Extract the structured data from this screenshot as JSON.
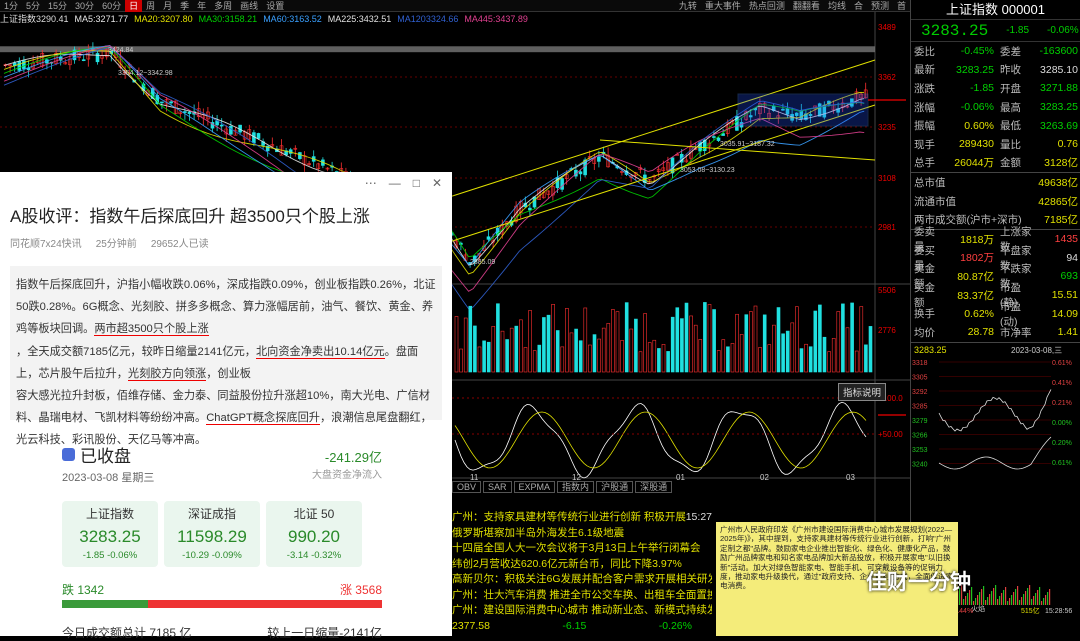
{
  "toolbar": {
    "tabs": [
      "1分",
      "5分",
      "15分",
      "30分",
      "60分",
      "日",
      "周",
      "月",
      "季",
      "年",
      "多周",
      "画线",
      "设置"
    ],
    "active": 5,
    "right": [
      "九转",
      "重大事件",
      "热点回测",
      "翻翻看",
      "均线",
      "合",
      "预测",
      "首"
    ]
  },
  "ma_legend": [
    {
      "label": "上证指数",
      "value": "3290.41",
      "color": "#ddd"
    },
    {
      "label": "MA5:",
      "value": "3271.77",
      "color": "#e8e8e8"
    },
    {
      "label": "MA20:",
      "value": "3207.80",
      "color": "#e0e000"
    },
    {
      "label": "MA30:",
      "value": "3158.21",
      "color": "#00d000"
    },
    {
      "label": "MA60:",
      "value": "3163.52",
      "color": "#3aa0ff"
    },
    {
      "label": "MA225:",
      "value": "3432.51",
      "color": "#e0e0e0"
    },
    {
      "label": "MA120",
      "value": "3324.66",
      "color": "#3060d0"
    },
    {
      "label": "MA445:",
      "value": "3437.89",
      "color": "#e04090"
    }
  ],
  "price_axis": [
    "3489",
    "3362",
    "3235",
    "3108",
    "2981",
    "5506",
    "2776",
    "+100.0",
    "+50.00"
  ],
  "chart_labels": {
    "high": "3424.84",
    "l1": "3354.12~3342.98",
    "low": "2885.09",
    "l2": "3035.91~3187.32",
    "l3": "3053.08~3130.23"
  },
  "dates": [
    "11",
    "12",
    "01",
    "02",
    "03"
  ],
  "indicator_tabs": [
    "OBV",
    "SAR",
    "EXPMA",
    "指数内",
    "沪股通",
    "深股通"
  ],
  "indicator_btn": "指标说明",
  "right_panel": {
    "title": "上证指数 000001",
    "price": "3283.25",
    "change": "-1.85",
    "pct": "-0.06%",
    "rows": [
      {
        "l": "委比",
        "v": "-0.45%",
        "vc": "g",
        "l2": "委差",
        "v2": "-163600",
        "v2c": "g"
      },
      {
        "l": "最新",
        "v": "3283.25",
        "vc": "g",
        "l2": "昨收",
        "v2": "3285.10",
        "v2c": "w"
      },
      {
        "l": "涨跌",
        "v": "-1.85",
        "vc": "g",
        "l2": "开盘",
        "v2": "3271.88",
        "v2c": "g"
      },
      {
        "l": "涨幅",
        "v": "-0.06%",
        "vc": "g",
        "l2": "最高",
        "v2": "3283.25",
        "v2c": "g"
      },
      {
        "l": "振幅",
        "v": "0.60%",
        "vc": "y",
        "l2": "最低",
        "v2": "3263.69",
        "v2c": "g"
      },
      {
        "l": "现手",
        "v": "289430",
        "vc": "y",
        "l2": "量比",
        "v2": "0.76",
        "v2c": "y"
      },
      {
        "l": "总手",
        "v": "26044万",
        "vc": "y",
        "l2": "金额",
        "v2": "3128亿",
        "v2c": "y"
      }
    ],
    "rows2": [
      {
        "l": "总市值",
        "v": "49638亿",
        "vc": "y"
      },
      {
        "l": "流通市值",
        "v": "42865亿",
        "vc": "y"
      },
      {
        "l": "两市成交额(沪市+深市)",
        "v": "7185亿",
        "vc": "y"
      }
    ],
    "rows3": [
      {
        "l": "委卖量",
        "v": "1818万",
        "vc": "y",
        "l2": "上涨家数",
        "v2": "1435",
        "v2c": "r"
      },
      {
        "l": "委买量",
        "v": "1802万",
        "vc": "r",
        "l2": "平盘家数",
        "v2": "94",
        "v2c": "w"
      },
      {
        "l": "卖金额",
        "v": "80.87亿",
        "vc": "y",
        "l2": "下跌家数",
        "v2": "693",
        "v2c": "g"
      },
      {
        "l": "买金额",
        "v": "83.37亿",
        "vc": "y",
        "l2": "市盈(静)",
        "v2": "15.51",
        "v2c": "y"
      },
      {
        "l": "换手",
        "v": "0.62%",
        "vc": "y",
        "l2": "市盈(动)",
        "v2": "14.09",
        "v2c": "y"
      },
      {
        "l": "均价",
        "v": "28.78",
        "vc": "y",
        "l2": "市净率",
        "v2": "1.41",
        "v2c": "y"
      }
    ],
    "mini": {
      "left": "3283.25",
      "date": "2023-03-08,三",
      "ticks": [
        "3318",
        "3305",
        "3292",
        "3285",
        "3279",
        "3266",
        "3253",
        "3240"
      ],
      "pcts": [
        "0.61%",
        "0.41%",
        "0.21%",
        "0.00%",
        "0.20%",
        "0.61%"
      ],
      "bottom": "-0.44%",
      "bottom2": "515亿",
      "time": "15:28:56",
      "cap": "火焰"
    }
  },
  "popup": {
    "title": "A股收评：指数午后探底回升 超3500只个股上涨",
    "source": "同花顺7x24快讯",
    "time": "25分钟前",
    "reads": "29652人已读",
    "body": [
      "指数午后探底回升，沪指小幅收跌0.06%，深成指跌0.09%，创业板指跌0.26%，北证",
      "50跌0.28%。6G概念、光刻胶、拼多多概念、算力涨幅居前，油气、餐饮、黄金、养",
      "鸡等板块回调。",
      "两市超3500只个股上涨",
      "，全天成交额7185亿元，较昨日缩量2141亿",
      "元，",
      "北向资金净卖出10.14亿元",
      "。盘面上，芯片股午后拉升，",
      "光刻胶方向领涨",
      "，创业板",
      "容大感光拉升封板，佰维存储、金力泰、同益股份拉升涨超10%，南大光电、广信材",
      "料、晶瑞电材、飞凯材料等纷纷冲高。",
      "ChatGPT概念探底回升",
      "，浪潮信息尾盘翻红，",
      "光云科技、彩讯股份、天亿马等冲高。"
    ],
    "closed": {
      "title": "已收盘",
      "flow": "-241.29亿",
      "flow_label": "大盘资金净流入",
      "date": "2023-03-08  星期三",
      "cards": [
        {
          "n": "上证指数",
          "v": "3283.25",
          "d": "-1.85  -0.06%"
        },
        {
          "n": "深证成指",
          "v": "11598.29",
          "d": "-10.29  -0.09%"
        },
        {
          "n": "北证 50",
          "v": "990.20",
          "d": "-3.14  -0.32%"
        }
      ],
      "down": "跌 1342",
      "up": "涨 3568",
      "total": "今日成交额总计 7185 亿",
      "vs": "较上一日缩量-2141亿"
    }
  },
  "news": [
    "广州：支持家具建材等传统行业进行创新 积极开展家电\"以旧换新\"活动",
    "15:27",
    "俄罗斯堪察加半岛外海发生6.1级地震",
    "十四届全国人大一次会议将于3月13日上午举行闭幕会",
    "纬创2月营收达620.6亿元新台币，同比下降3.97%",
    "高新贝尔：积极关注6G发展并配合客户需求开展相关研发",
    "广州：壮大汽车消费 推进全市公交车换、出租车全面置换",
    "广州：建设国际消费中心城市 推动新业态、新模式持续发展"
  ],
  "news_bottom": {
    "v1": "2377.58",
    "v2": "-6.15",
    "v3": "-0.26%"
  },
  "note": "广州市人民政府印发《广州市建设国际消费中心城市发展规划(2022—2025年)》，其中提到，支持家具建材等传统行业进行创新，打响\"广州定制之都\"品牌。鼓励家电企业推出智能化、绿色化、健康化产品，鼓励广州品牌家电和知名家电品牌加大新品投放，积极开展家电\"以旧换新\"活动。加大对绿色智能家电、智能手机、可穿戴设备等的促销力度，推动家电升级换代，通过\"政府支持、企业让利\"方式，全面促进家电消费。",
  "brand": "佳财一分钟"
}
